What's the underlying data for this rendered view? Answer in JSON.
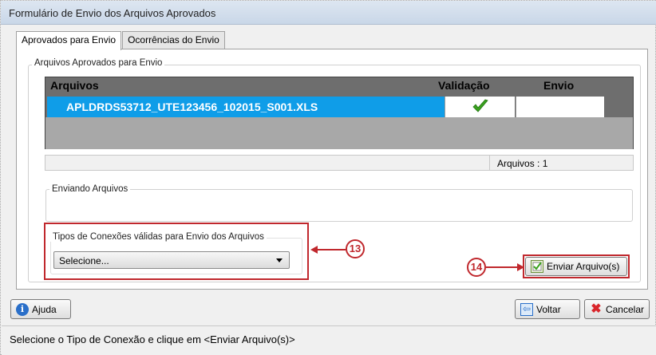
{
  "window": {
    "title": "Formulário de Envio dos Arquivos Aprovados"
  },
  "tabs": [
    {
      "label": "Aprovados para Envio",
      "active": true
    },
    {
      "label": "Ocorrências do Envio",
      "active": false
    }
  ],
  "approved_group": {
    "label": "Arquivos Aprovados para Envio",
    "grid": {
      "columns": [
        "Arquivos",
        "Validação",
        "Envio"
      ],
      "rows": [
        {
          "file": "APLDRDS53712_UTE123456_102015_S001.XLS",
          "validation_icon": "check-icon",
          "envio": ""
        }
      ]
    },
    "count_label": "Arquivos : 1"
  },
  "sending_group": {
    "label": "Enviando Arquivos"
  },
  "connection_group": {
    "label": "Tipos de Conexões válidas para Envio dos Arquivos",
    "select_value": "Selecione..."
  },
  "callouts": {
    "c13": "13",
    "c14": "14"
  },
  "buttons": {
    "send": "Enviar Arquivo(s)",
    "help": "Ajuda",
    "back": "Voltar",
    "cancel": "Cancelar"
  },
  "status_bar": {
    "text": "Selecione o Tipo de Conexão e clique em <Enviar Arquivo(s)>"
  },
  "colors": {
    "highlight": "#c0282d",
    "selection": "#0f9de8",
    "check": "#3aa21e"
  }
}
